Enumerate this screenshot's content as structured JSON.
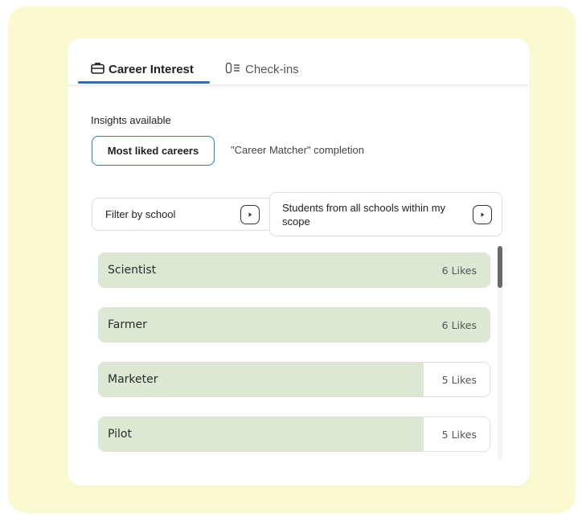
{
  "tabs": [
    {
      "label": "Career Interest",
      "icon": "briefcase-icon",
      "active": true
    },
    {
      "label": "Check-ins",
      "icon": "checklist-icon",
      "active": false
    }
  ],
  "insights": {
    "label": "Insights available",
    "options": [
      {
        "label": "Most liked careers",
        "selected": true
      },
      {
        "label": "\"Career Matcher\" completion",
        "selected": false
      }
    ]
  },
  "filter": {
    "label": "Filter by school",
    "scope_label": "Students from all schools within my scope"
  },
  "careers": [
    {
      "name": "Scientist",
      "likes": 6,
      "likes_label": "6 Likes"
    },
    {
      "name": "Farmer",
      "likes": 6,
      "likes_label": "6 Likes"
    },
    {
      "name": "Marketer",
      "likes": 5,
      "likes_label": "5 Likes"
    },
    {
      "name": "Pilot",
      "likes": 5,
      "likes_label": "5 Likes"
    }
  ],
  "max_likes": 6,
  "colors": {
    "accent": "#1f6fd1",
    "bar_fill": "#dde8d3",
    "backdrop": "#fafad0"
  }
}
